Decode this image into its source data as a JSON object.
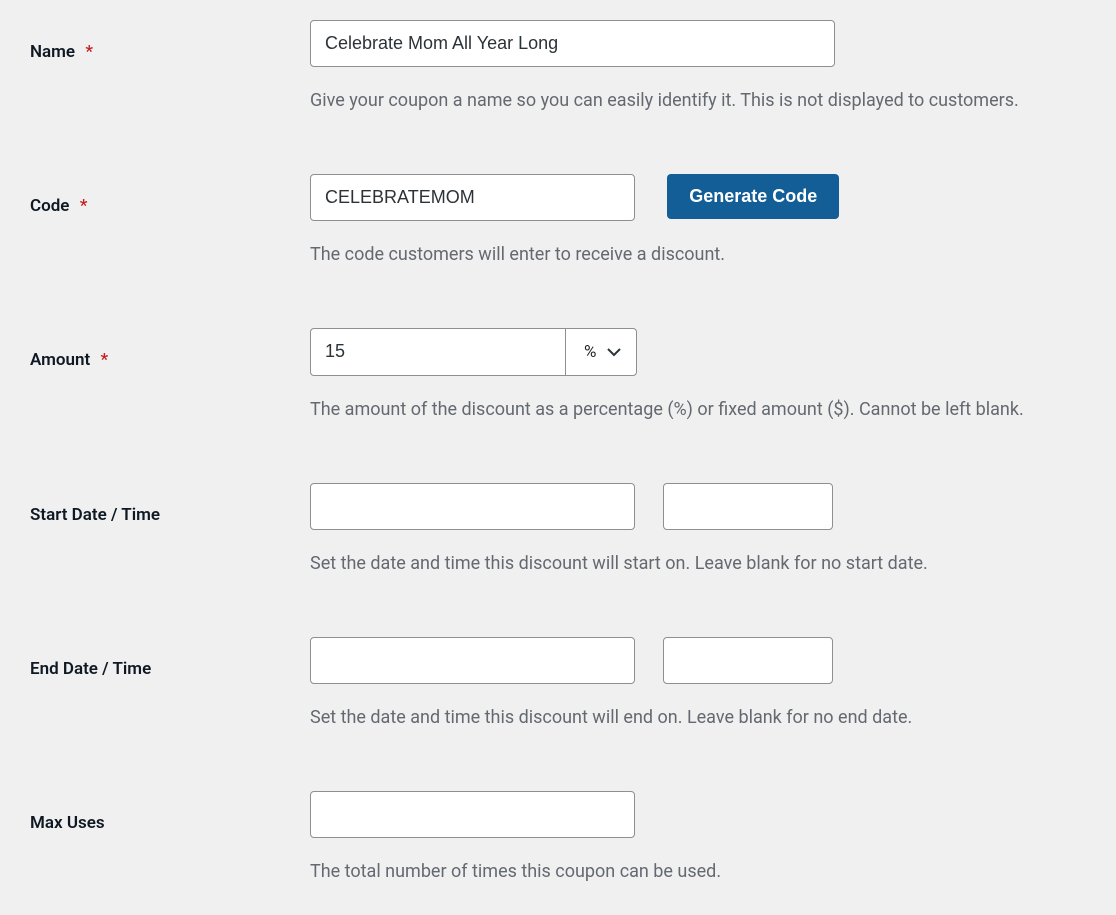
{
  "fields": {
    "name": {
      "label": "Name",
      "required": "*",
      "value": "Celebrate Mom All Year Long",
      "help": "Give your coupon a name so you can easily identify it. This is not displayed to customers."
    },
    "code": {
      "label": "Code",
      "required": "*",
      "value": "CELEBRATEMOM",
      "help": "The code customers will enter to receive a discount.",
      "generate_button": "Generate Code"
    },
    "amount": {
      "label": "Amount",
      "required": "*",
      "value": "15",
      "unit": "%",
      "help": "The amount of the discount as a percentage (%) or fixed amount ($). Cannot be left blank."
    },
    "start_date": {
      "label": "Start Date / Time",
      "date_value": "",
      "time_value": "",
      "help": "Set the date and time this discount will start on. Leave blank for no start date."
    },
    "end_date": {
      "label": "End Date / Time",
      "date_value": "",
      "time_value": "",
      "help": "Set the date and time this discount will end on. Leave blank for no end date."
    },
    "max_uses": {
      "label": "Max Uses",
      "value": "",
      "help": "The total number of times this coupon can be used."
    }
  }
}
